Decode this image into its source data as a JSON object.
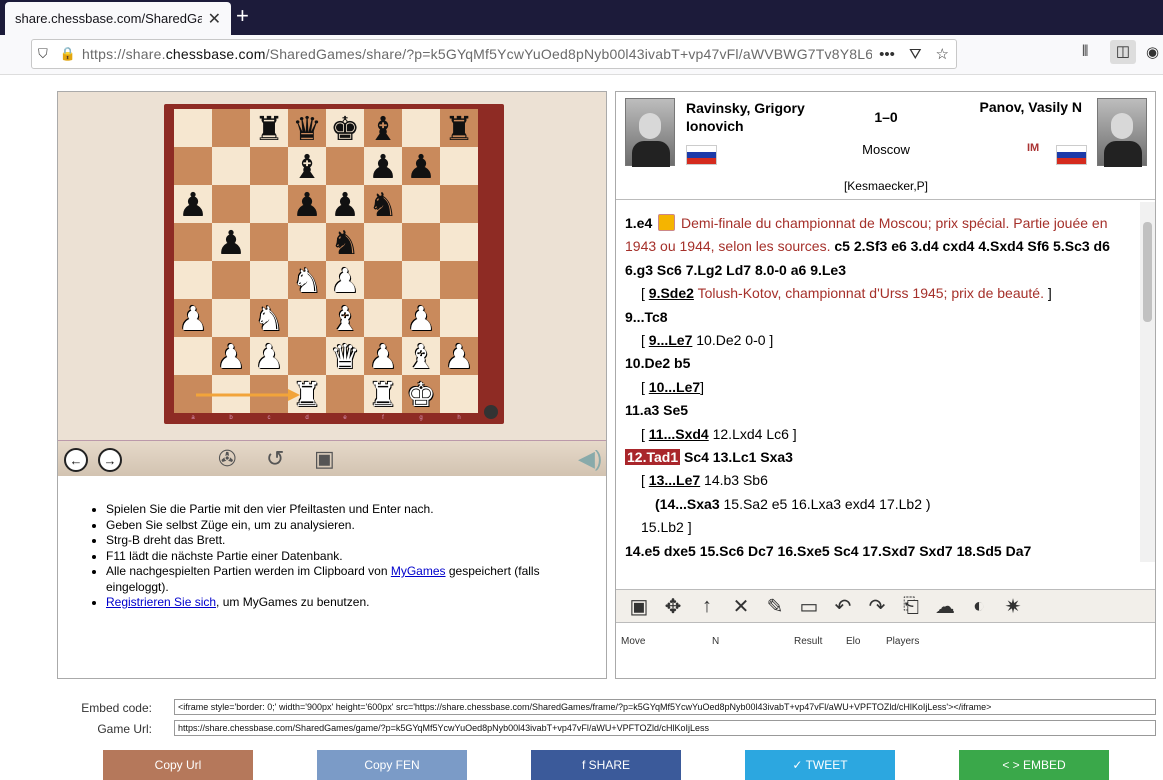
{
  "browser": {
    "tab_title": "share.chessbase.com/SharedGames",
    "url_prefix": "https://share.",
    "url_domain": "chessbase.com",
    "url_rest": "/SharedGames/share/?p=k5GYqMf5YcwYuOed8pNyb00l43ivabT+vp47vFl/aWVBWG7Tv8Y8L6"
  },
  "board": {
    "files": [
      "a",
      "b",
      "c",
      "d",
      "e",
      "f",
      "g",
      "h"
    ],
    "rows": [
      [
        "",
        "",
        "bR",
        "bQ",
        "bK",
        "bB",
        "",
        "bR"
      ],
      [
        "",
        "",
        "",
        "bB",
        "",
        "bP",
        "bP",
        ""
      ],
      [
        "bP",
        "",
        "",
        "bP",
        "bP",
        "bN",
        "",
        ""
      ],
      [
        "",
        "bP",
        "",
        "",
        "bN",
        "",
        "",
        ""
      ],
      [
        "",
        "",
        "",
        "wN",
        "wP",
        "",
        "",
        ""
      ],
      [
        "wP",
        "",
        "wN",
        "",
        "wB",
        "",
        "wP",
        ""
      ],
      [
        "",
        "wP",
        "wP",
        "",
        "wQ",
        "wP",
        "wB",
        "wP"
      ],
      [
        "",
        "",
        "",
        "wR",
        "",
        "wR",
        "wK",
        ""
      ]
    ]
  },
  "game": {
    "white_name": "Ravinsky, Grigory Ionovich",
    "black_name": "Panov, Vasily N",
    "result": "1–0",
    "place": "Moscow",
    "black_title": "IM",
    "annotator": "[Kesmaecker,P]"
  },
  "moves": {
    "l1_a": "1.e4",
    "l1_c": "Demi-finale du championnat de Moscou; prix spécial. Partie jouée en 1943 ou 1944, selon les sources.",
    "l1_b": "c5 2.Sf3 e6 3.d4 cxd4 4.Sxd4 Sf6 5.Sc3 d6 6.g3 Sc6 7.Lg2 Ld7 8.0-0 a6 9.Le3",
    "v1_open": "[",
    "v1_move": "9.Sde2",
    "v1_comment": "Tolush-Kotov, championnat d'Urss 1945; prix de beauté.",
    "v1_close": "]",
    "l2": "9...Tc8",
    "v2_move": "9...Le7",
    "v2_rest": "10.De2 0-0 ]",
    "l3": "10.De2 b5",
    "v3_move": "10...Le7",
    "l4": "11.a3 Se5",
    "v4_move": "11...Sxd4",
    "v4_rest": "12.Lxd4 Lc6 ]",
    "cur": "12.Tad1",
    "l5_rest": "Sc4 13.Lc1 Sxa3",
    "v5_move": "13...Le7",
    "v5_rest": "14.b3 Sb6",
    "v6_move": "(14...Sxa3",
    "v6_rest": "15.Sa2 e5 16.Lxa3 exd4 17.Lb2 )",
    "v7": "15.Lb2 ]",
    "l6": "14.e5 dxe5 15.Sc6 Dc7 16.Sxe5 Sc4 17.Sxd7 Sxd7 18.Sd5 Da7"
  },
  "table": {
    "move": "Move",
    "n": "N",
    "result": "Result",
    "elo": "Elo",
    "players": "Players"
  },
  "help": {
    "i1": "Spielen Sie die Partie mit den vier Pfeiltasten und Enter nach.",
    "i2": "Geben Sie selbst Züge ein, um zu analysieren.",
    "i3": "Strg-B dreht das Brett.",
    "i4": "F11 lädt die nächste Partie einer Datenbank.",
    "i5_pre": "Alle nachgespielten Partien werden im Clipboard von ",
    "i5_link": "MyGames",
    "i5_post": " gespeichert (falls eingeloggt).",
    "i6_link": "Registrieren Sie sich",
    "i6_post": ", um MyGames zu benutzen."
  },
  "embed": {
    "embed_label": "Embed code:",
    "embed_value": "<iframe style='border: 0;' width='900px' height='600px' src='https://share.chessbase.com/SharedGames/frame/?p=k5GYqMf5YcwYuOed8pNyb00l43ivabT+vp47vFl/aWU+VPFTOZld/cHlKoIjLess'></iframe>",
    "url_label": "Game Url:",
    "url_value": "https://share.chessbase.com/SharedGames/game/?p=k5GYqMf5YcwYuOed8pNyb00l43ivabT+vp47vFl/aWU+VPFTOZld/cHlKoIjLess"
  },
  "buttons": {
    "copy_url": "Copy Url",
    "copy_fen": "Copy FEN",
    "share": "f SHARE",
    "tweet": "✓ TWEET",
    "embed": "< > EMBED"
  },
  "colors": {
    "copy_url": "#b5785b",
    "copy_fen": "#7b9bc7",
    "share": "#3b5a9a",
    "tweet": "#2ca7e0",
    "embed": "#3aa84a"
  },
  "icons": {
    "pieces": {
      "K": "♚",
      "Q": "♛",
      "R": "♜",
      "B": "♝",
      "N": "♞",
      "P": "♟"
    }
  }
}
